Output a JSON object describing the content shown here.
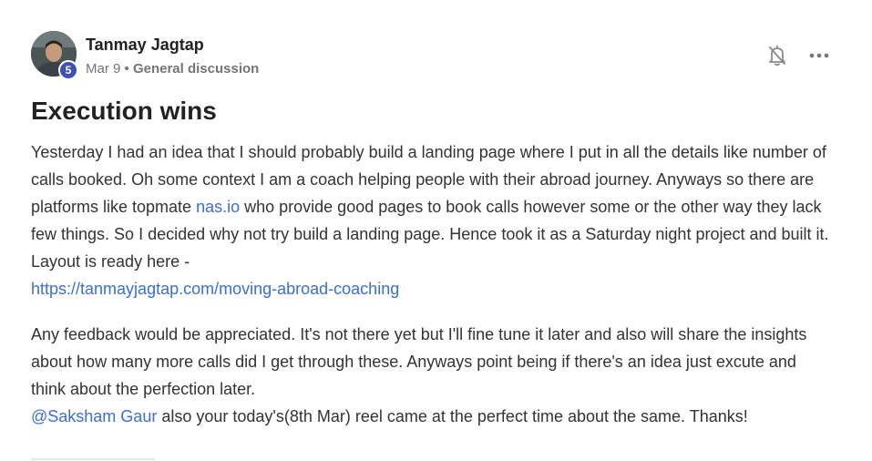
{
  "post": {
    "author": "Tanmay Jagtap",
    "level": "5",
    "date": "Mar 9",
    "separator": " • ",
    "category": "General discussion",
    "title": "Execution wins",
    "p1_text1": "Yesterday I had an idea that I should probably build a landing page where I put in all the details like number of calls booked. Oh some context I am a coach helping people with their abroad journey. Anyways so there are platforms like topmate ",
    "p1_link1": "nas.io",
    "p1_text2": " who provide good pages to book calls however some or the other way they lack few things. So I decided why not try build a landing page. Hence took it as a Saturday night project and built it. Layout is ready here -",
    "p1_link2": "https://tanmayjagtap.com/moving-abroad-coaching",
    "p2_text1": "Any feedback would be appreciated. It's not there yet but I'll fine tune it later and also will share the insights about how many more calls did I get through these. Anyways point being if there's an idea just excute and think about the perfection later.",
    "p2_mention": "@Saksham Gaur",
    "p2_text2": " also your today's(8th Mar) reel came at the perfect time about the same. Thanks!"
  },
  "icons": {
    "notify": "bell-off-icon",
    "more": "more-horizontal-icon"
  }
}
